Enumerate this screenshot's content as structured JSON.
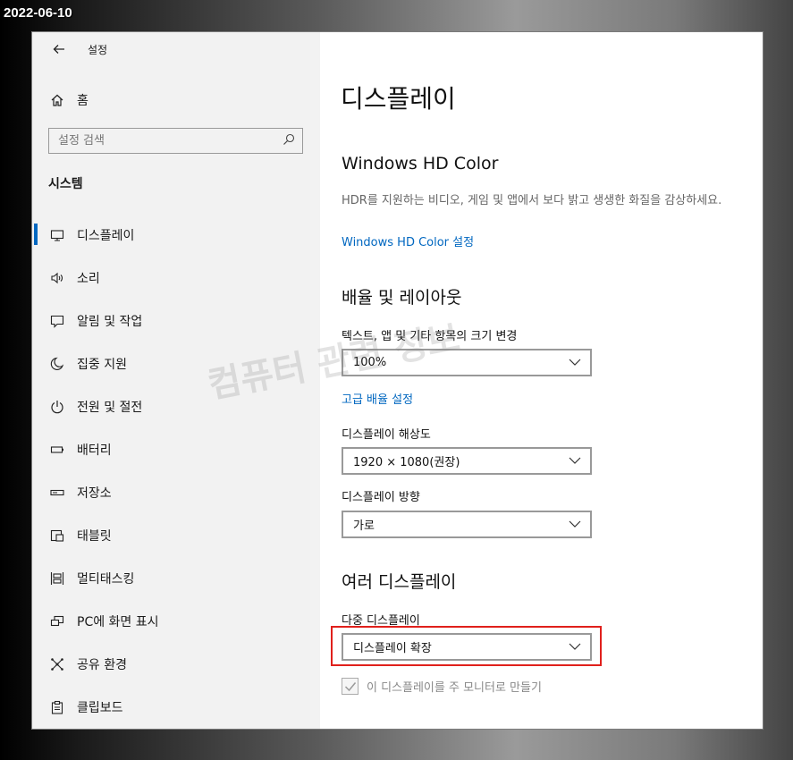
{
  "date_stamp": "2022-06-10",
  "window": {
    "title": "설정"
  },
  "sidebar": {
    "home_label": "홈",
    "search_placeholder": "설정 검색",
    "section_title": "시스템",
    "items": [
      {
        "label": "디스플레이",
        "icon": "monitor-icon",
        "active": true
      },
      {
        "label": "소리",
        "icon": "speaker-icon"
      },
      {
        "label": "알림 및 작업",
        "icon": "notification-icon"
      },
      {
        "label": "집중 지원",
        "icon": "moon-icon"
      },
      {
        "label": "전원 및 절전",
        "icon": "power-icon"
      },
      {
        "label": "배터리",
        "icon": "battery-icon"
      },
      {
        "label": "저장소",
        "icon": "storage-icon"
      },
      {
        "label": "태블릿",
        "icon": "tablet-icon"
      },
      {
        "label": "멀티태스킹",
        "icon": "multitasking-icon"
      },
      {
        "label": "PC에 화면 표시",
        "icon": "project-icon"
      },
      {
        "label": "공유 환경",
        "icon": "shared-experience-icon"
      },
      {
        "label": "클립보드",
        "icon": "clipboard-icon"
      }
    ]
  },
  "main": {
    "title": "디스플레이",
    "hdr": {
      "heading": "Windows HD Color",
      "description": "HDR를 지원하는 비디오, 게임 및 앱에서 보다 밝고 생생한 화질을 감상하세요.",
      "link": "Windows HD Color 설정"
    },
    "scale": {
      "heading": "배율 및 레이아웃",
      "text_size_label": "텍스트, 앱 및 기타 항목의 크기 변경",
      "text_size_value": "100%",
      "advanced_link": "고급 배율 설정",
      "resolution_label": "디스플레이 해상도",
      "resolution_value": "1920 × 1080(권장)",
      "orientation_label": "디스플레이 방향",
      "orientation_value": "가로"
    },
    "multi": {
      "heading": "여러 디스플레이",
      "label": "다중 디스플레이",
      "value": "디스플레이 확장",
      "checkbox_label": "이 디스플레이를 주 모니터로 만들기"
    }
  },
  "watermark": "컴퓨터 관련 정보",
  "colors": {
    "accent": "#0067c0",
    "highlight_box": "#e0201c",
    "sidebar_bg": "#f2f2f2"
  }
}
